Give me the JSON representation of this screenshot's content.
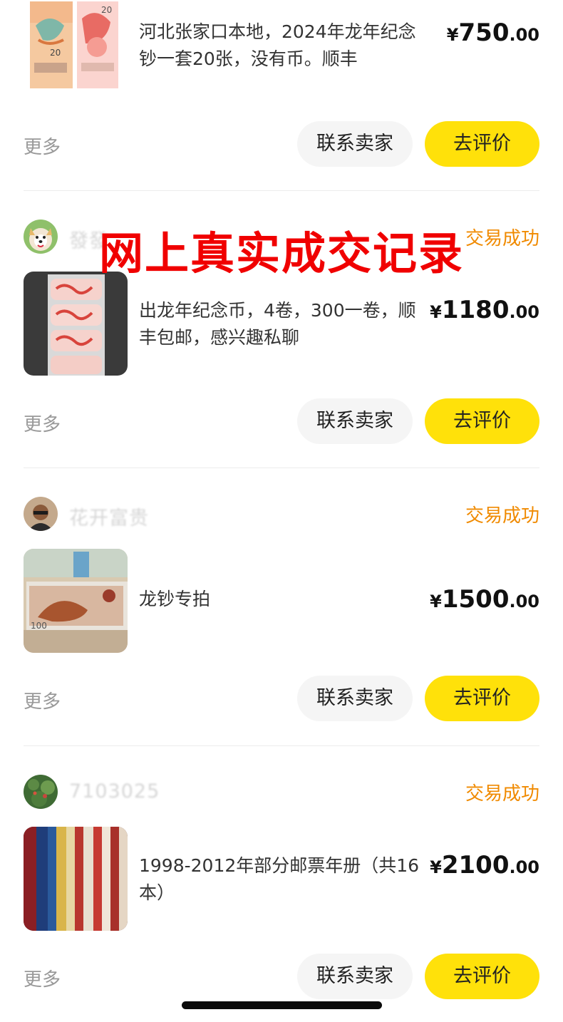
{
  "overlay_text": "网上真实成交记录",
  "orders": [
    {
      "seller": "",
      "status": "",
      "title": "河北张家口本地，2024年龙年纪念钞一套20张，没有币。顺丰",
      "price": {
        "symbol": "¥",
        "integer": "750",
        "decimal": ".00"
      },
      "more_label": "更多",
      "contact_label": "联系卖家",
      "review_label": "去评价"
    },
    {
      "seller": "發發",
      "status": "交易成功",
      "title": "出龙年纪念币，4卷，300一卷，顺丰包邮，感兴趣私聊",
      "price": {
        "symbol": "¥",
        "integer": "1180",
        "decimal": ".00"
      },
      "more_label": "更多",
      "contact_label": "联系卖家",
      "review_label": "去评价"
    },
    {
      "seller": "花开富贵",
      "status": "交易成功",
      "title": "龙钞专拍",
      "price": {
        "symbol": "¥",
        "integer": "1500",
        "decimal": ".00"
      },
      "more_label": "更多",
      "contact_label": "联系卖家",
      "review_label": "去评价"
    },
    {
      "seller": "7103025",
      "status": "交易成功",
      "title": "1998-2012年部分邮票年册（共16本）",
      "price": {
        "symbol": "¥",
        "integer": "2100",
        "decimal": ".00"
      },
      "more_label": "更多",
      "contact_label": "联系卖家",
      "review_label": "去评价"
    }
  ],
  "colors": {
    "accent_button": "#ffe10a",
    "status": "#f08a00",
    "overlay": "#f00000",
    "muted": "#999999"
  }
}
